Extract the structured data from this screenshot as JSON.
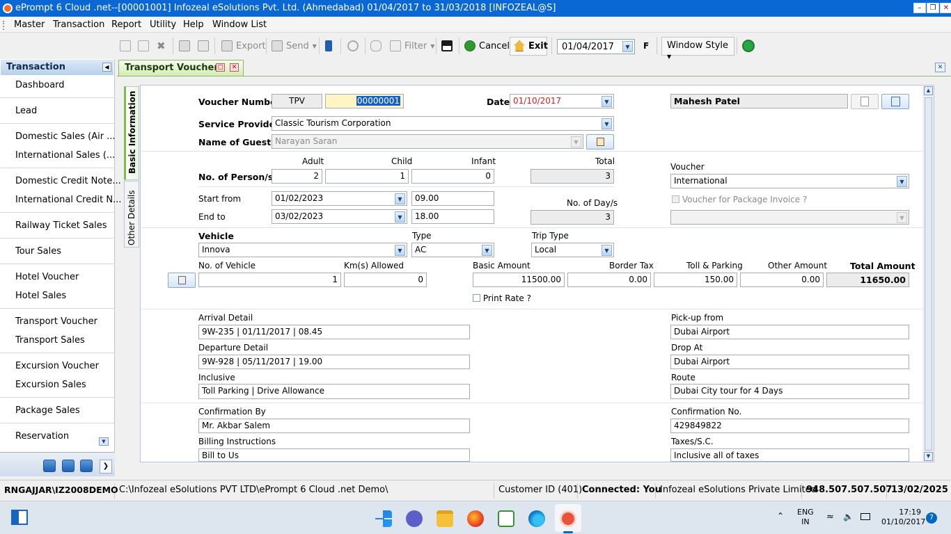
{
  "window": {
    "title": "ePrompt 6 Cloud .net--[00001001] Infozeal eSolutions Pvt. Ltd. (Ahmedabad) 01/04/2017 to 31/03/2018 [INFOZEAL@S]"
  },
  "menu": [
    "Master",
    "Transaction",
    "Report",
    "Utility",
    "Help",
    "Window List"
  ],
  "toolbar": {
    "export": "Export",
    "send": "Send",
    "filter": "Filter",
    "cancel": "Cancel",
    "exit": "Exit",
    "date": "01/04/2017",
    "f_label": "F",
    "window_style": "Window Style"
  },
  "sidebar": {
    "title": "Transaction",
    "items": [
      "Dashboard",
      "Lead",
      "Domestic Sales (Air ...",
      "International Sales (...",
      "Domestic Credit Note...",
      "International Credit N...",
      "Railway Ticket Sales",
      "Tour Sales",
      "Hotel Voucher",
      "Hotel Sales",
      "Transport Voucher",
      "Transport Sales",
      "Excursion Voucher",
      "Excursion Sales",
      "Package Sales",
      "Reservation"
    ]
  },
  "tab": {
    "title": "Transport Voucher"
  },
  "vtabs": {
    "basic": "Basic Information",
    "other": "Other Details"
  },
  "form": {
    "voucher_number_label": "Voucher Number",
    "voucher_prefix": "TPV",
    "voucher_number": "00000001",
    "date_label": "Date",
    "date": "01/10/2017",
    "user_name": "Mahesh Patel",
    "service_provider_label": "Service Provider",
    "service_provider": "Classic Tourism Corporation",
    "guest_label": "Name of Guest",
    "guest": "Narayan Saran",
    "persons_label": "No. of Person/s",
    "adult_label": "Adult",
    "child_label": "Child",
    "infant_label": "Infant",
    "total_label": "Total",
    "adult": "2",
    "child": "1",
    "infant": "0",
    "total": "3",
    "voucher_label": "Voucher",
    "voucher_type": "International",
    "package_invoice_label": "Voucher for Package Invoice ?",
    "start_label": "Start from",
    "start_date": "01/02/2023",
    "start_time": "09.00",
    "end_label": "End to",
    "end_date": "03/02/2023",
    "end_time": "18.00",
    "days_label": "No. of Day/s",
    "days": "3",
    "vehicle_label": "Vehicle",
    "vehicle": "Innova",
    "type_label": "Type",
    "type": "AC",
    "trip_type_label": "Trip Type",
    "trip_type": "Local",
    "num_vehicle_label": "No. of Vehicle",
    "num_vehicle": "1",
    "km_label": "Km(s) Allowed",
    "km": "0",
    "basic_amount_label": "Basic Amount",
    "basic_amount": "11500.00",
    "border_tax_label": "Border Tax",
    "border_tax": "0.00",
    "toll_label": "Toll & Parking",
    "toll": "150.00",
    "other_amount_label": "Other Amount",
    "other_amount": "0.00",
    "total_amount_label": "Total Amount",
    "total_amount": "11650.00",
    "print_rate_label": "Print Rate ?",
    "arrival_label": "Arrival Detail",
    "arrival": "9W-235 | 01/11/2017 | 08.45",
    "pickup_label": "Pick-up from",
    "pickup": "Dubai Airport",
    "departure_label": "Departure Detail",
    "departure": "9W-928 | 05/11/2017 | 19.00",
    "drop_label": "Drop At",
    "drop": "Dubai Airport",
    "inclusive_label": "Inclusive",
    "inclusive": "Toll Parking | Drive Allowance",
    "route_label": "Route",
    "route": "Dubai City tour for 4 Days",
    "confirmation_by_label": "Confirmation By",
    "confirmation_by": "Mr. Akbar Salem",
    "confirmation_no_label": "Confirmation No.",
    "confirmation_no": "429849822",
    "billing_label": "Billing Instructions",
    "billing": "Bill to Us",
    "taxes_label": "Taxes/S.C.",
    "taxes": "Inclusive all of taxes"
  },
  "status": {
    "user": "RNGAJJAR\\IZ2008DEMO",
    "path": "C:\\Infozeal eSolutions PVT LTD\\ePrompt 6 Cloud .net Demo\\",
    "customer": "Customer ID (401)",
    "connected": "Connected: You",
    "company": "Infozeal eSolutions Private Limited",
    "phone": "948.507.507.507",
    "date": "13/02/2025"
  },
  "taskbar": {
    "lang1": "ENG",
    "lang2": "IN",
    "time": "17:19",
    "date": "01/10/2017",
    "notifications": "7"
  },
  "colors": {
    "titlebar": "#0a68d4",
    "date_red": "#d42020",
    "tab_green": "#d4ecb4"
  }
}
